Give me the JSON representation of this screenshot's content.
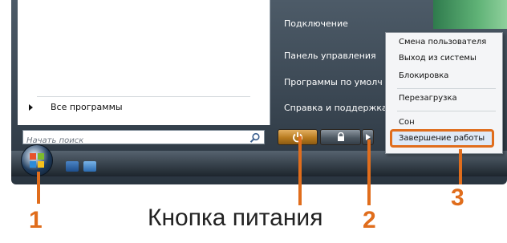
{
  "start_menu": {
    "all_programs": "Все программы",
    "search_placeholder": "Начать поиск",
    "right_pane": [
      {
        "label": "Подключение"
      },
      {
        "label": "Панель управления"
      },
      {
        "label": "Программы по умолч"
      },
      {
        "label": "Справка и поддержка"
      }
    ]
  },
  "power_submenu": {
    "items": [
      {
        "label": "Смена пользователя"
      },
      {
        "label": "Выход из системы"
      },
      {
        "label": "Блокировка"
      },
      {
        "label": "Перезагрузка"
      },
      {
        "label": "Сон"
      },
      {
        "label": "Завершение работы"
      }
    ]
  },
  "annotations": {
    "marker_1": "1",
    "marker_2": "2",
    "marker_3": "3",
    "caption": "Кнопка питания"
  },
  "colors": {
    "accent_orange": "#e06d1c",
    "power_button": "#c8892a",
    "menu_dark": "#2a3540"
  },
  "icons": [
    "search-icon",
    "power-icon",
    "lock-icon",
    "arrow-right-icon",
    "windows-logo-icon"
  ]
}
